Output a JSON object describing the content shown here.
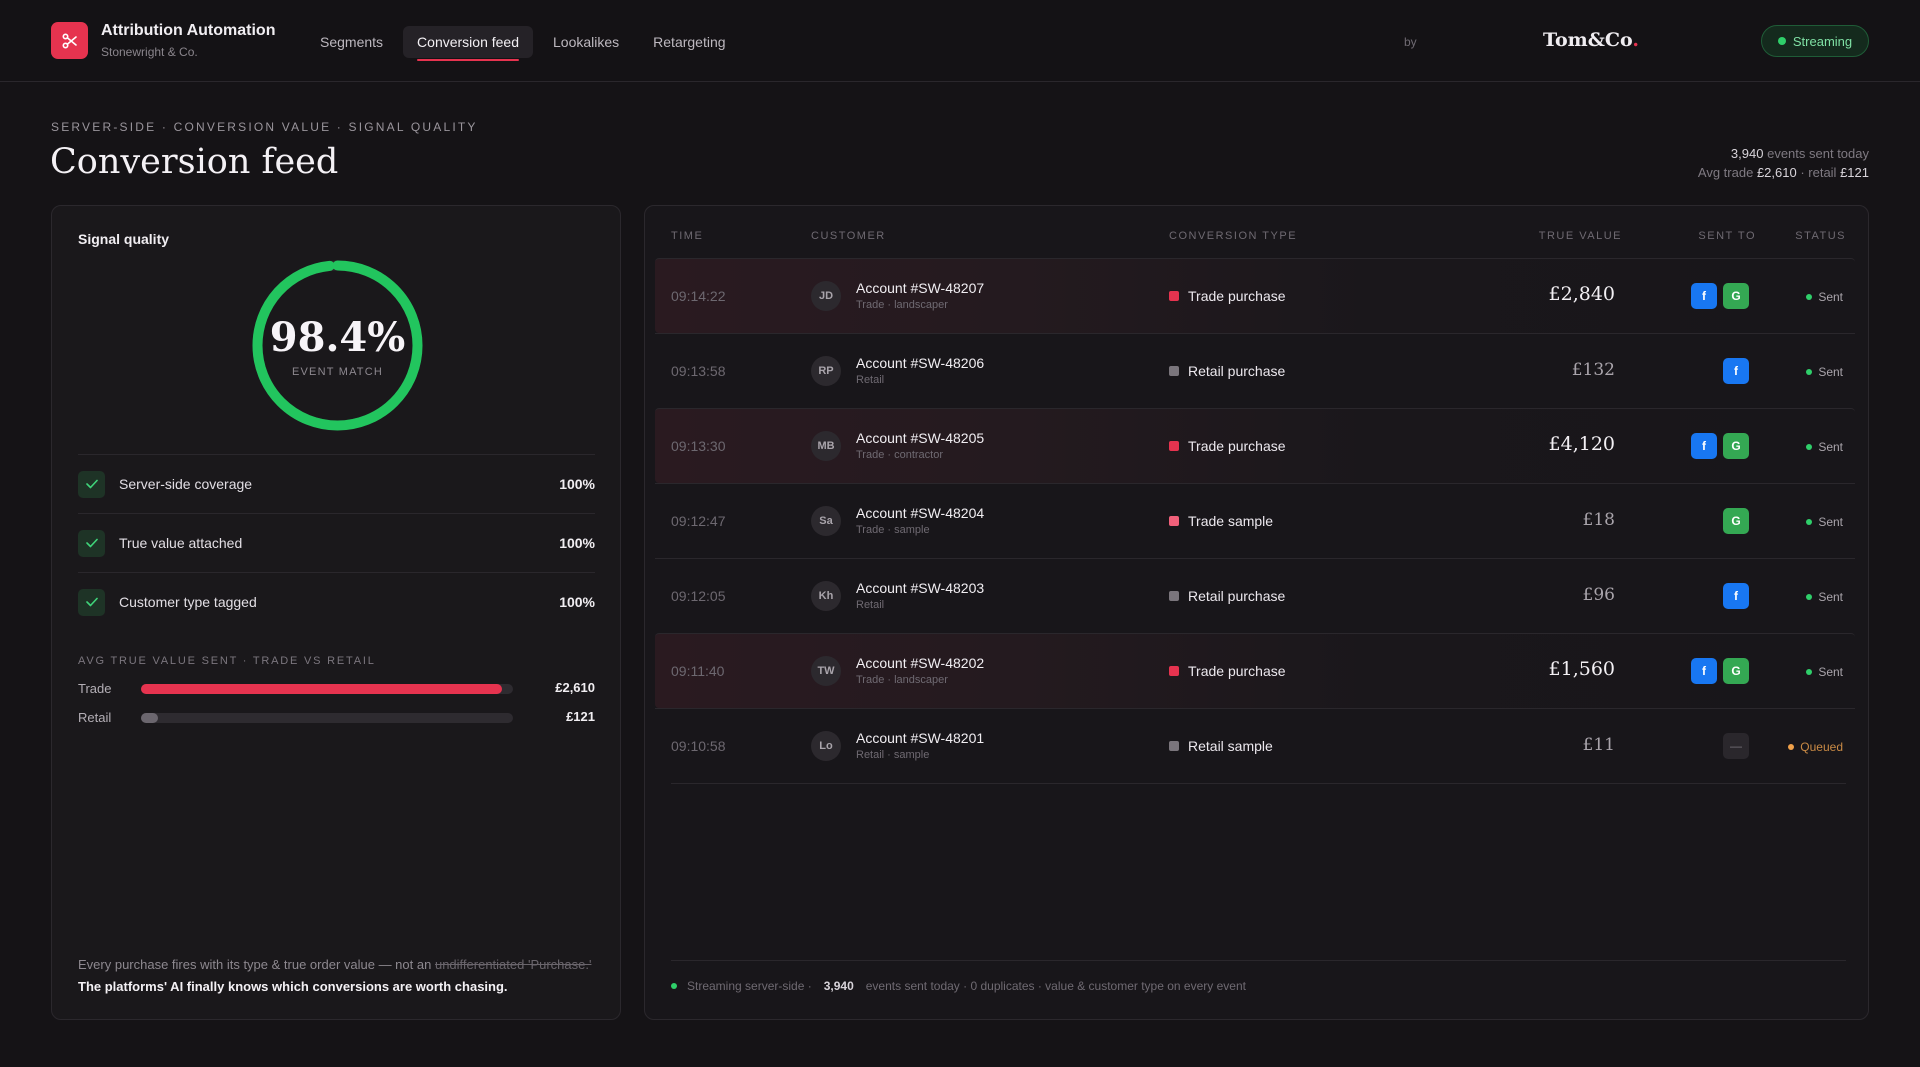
{
  "app": {
    "title": "Attribution Automation",
    "subtitle": "Stonewright & Co.",
    "by": "by",
    "brand_main": "Tom&Co",
    "brand_dot": ".",
    "accent_color": "#e6334f"
  },
  "nav": [
    {
      "label": "Segments",
      "active": false
    },
    {
      "label": "Conversion feed",
      "active": true
    },
    {
      "label": "Lookalikes",
      "active": false
    },
    {
      "label": "Retargeting",
      "active": false
    }
  ],
  "streaming_badge": "Streaming",
  "header": {
    "eyebrow": "SERVER-SIDE · CONVERSION VALUE · SIGNAL QUALITY",
    "title": "Conversion feed",
    "events_count": "3,940",
    "events_text": "events sent today",
    "avg_trade_label": "Avg trade",
    "avg_trade": "£2,610",
    "retail_label": "· retail",
    "avg_retail": "£121"
  },
  "signal": {
    "title": "Signal quality",
    "match_value": "98.4%",
    "match_fraction": 0.984,
    "match_label": "EVENT MATCH",
    "checks": [
      {
        "label": "Server-side coverage",
        "value": "100%"
      },
      {
        "label": "True value attached",
        "value": "100%"
      },
      {
        "label": "Customer type tagged",
        "value": "100%"
      }
    ],
    "avg_label": "AVG TRUE VALUE SENT · TRADE VS RETAIL",
    "bars": [
      {
        "name": "Trade",
        "value": "£2,610",
        "fraction": 0.97,
        "color": "#e6334f"
      },
      {
        "name": "Retail",
        "value": "£121",
        "fraction": 0.045,
        "color": "#6b666e"
      }
    ],
    "footnote_pre": "Every purchase fires with its type & true order value — not an",
    "footnote_strike": "undifferentiated 'Purchase.'",
    "footnote_bold": "The platforms' AI finally knows which conversions are worth chasing."
  },
  "table": {
    "columns": {
      "time": "TIME",
      "customer": "CUSTOMER",
      "type": "CONVERSION TYPE",
      "value": "TRUE VALUE",
      "sent_to": "SENT TO",
      "status": "STATUS"
    },
    "rows": [
      {
        "time": "09:14:22",
        "initials": "JD",
        "account": "Account #SW-48207",
        "segment": "Trade · landscaper",
        "type": "Trade purchase",
        "type_color": "#e6334f",
        "value": "£2,840",
        "trade": true,
        "platforms": [
          "f",
          "G"
        ],
        "status": "Sent",
        "status_color": "#2fcf6a"
      },
      {
        "time": "09:13:58",
        "initials": "RP",
        "account": "Account #SW-48206",
        "segment": "Retail",
        "type": "Retail purchase",
        "type_color": "#7a757c",
        "value": "£132",
        "trade": false,
        "platforms": [
          "f"
        ],
        "status": "Sent",
        "status_color": "#2fcf6a"
      },
      {
        "time": "09:13:30",
        "initials": "MB",
        "account": "Account #SW-48205",
        "segment": "Trade · contractor",
        "type": "Trade purchase",
        "type_color": "#e6334f",
        "value": "£4,120",
        "trade": true,
        "platforms": [
          "f",
          "G"
        ],
        "status": "Sent",
        "status_color": "#2fcf6a"
      },
      {
        "time": "09:12:47",
        "initials": "Sa",
        "account": "Account #SW-48204",
        "segment": "Trade · sample",
        "type": "Trade sample",
        "type_color": "#f0607a",
        "value": "£18",
        "trade": false,
        "platforms": [
          "G"
        ],
        "status": "Sent",
        "status_color": "#2fcf6a"
      },
      {
        "time": "09:12:05",
        "initials": "Kh",
        "account": "Account #SW-48203",
        "segment": "Retail",
        "type": "Retail purchase",
        "type_color": "#7a757c",
        "value": "£96",
        "trade": false,
        "platforms": [
          "f"
        ],
        "status": "Sent",
        "status_color": "#2fcf6a"
      },
      {
        "time": "09:11:40",
        "initials": "TW",
        "account": "Account #SW-48202",
        "segment": "Trade · landscaper",
        "type": "Trade purchase",
        "type_color": "#e6334f",
        "value": "£1,560",
        "trade": true,
        "platforms": [
          "f",
          "G"
        ],
        "status": "Sent",
        "status_color": "#2fcf6a"
      },
      {
        "time": "09:10:58",
        "initials": "Lo",
        "account": "Account #SW-48201",
        "segment": "Retail · sample",
        "type": "Retail sample",
        "type_color": "#7a757c",
        "value": "£11",
        "trade": false,
        "platforms": [
          "—"
        ],
        "status": "Queued",
        "status_color": "#f0a14a"
      }
    ],
    "footer_pre": "Streaming server-side ·",
    "footer_count": "3,940",
    "footer_post": "events sent today · 0 duplicates · value & customer type on every event"
  }
}
